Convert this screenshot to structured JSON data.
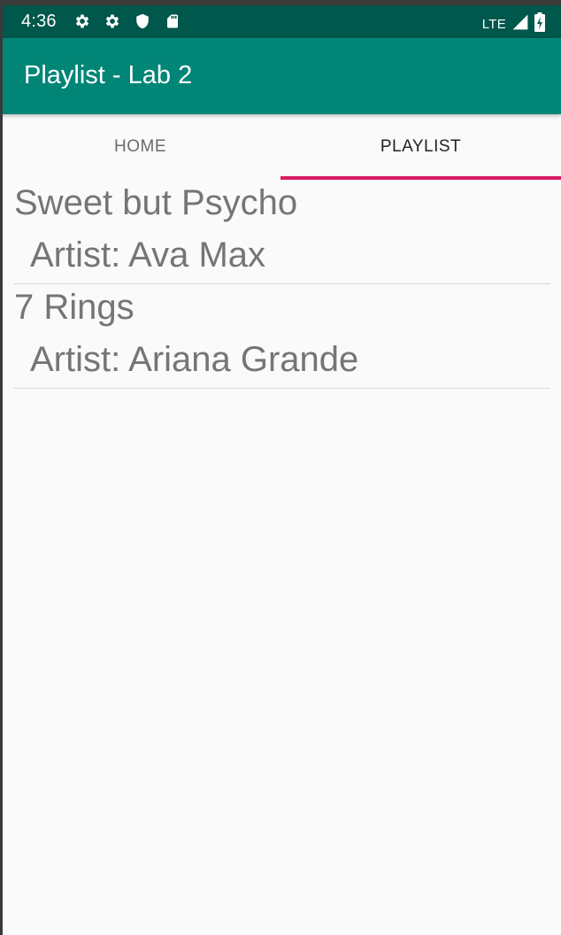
{
  "status_bar": {
    "time": "4:36",
    "network": "LTE",
    "icons": [
      "settings-icon",
      "settings-icon",
      "shield-icon",
      "sd-card-icon",
      "signal-icon",
      "battery-charging-icon"
    ]
  },
  "app_bar": {
    "title": "Playlist - Lab 2",
    "color": "#008577"
  },
  "tabs": [
    {
      "label": "HOME",
      "active": false
    },
    {
      "label": "PLAYLIST",
      "active": true
    }
  ],
  "accent_color": "#d81b60",
  "songs": [
    {
      "title": "Sweet but Psycho",
      "artist": "Artist: Ava Max"
    },
    {
      "title": "7 Rings",
      "artist": "Artist: Ariana Grande"
    }
  ]
}
